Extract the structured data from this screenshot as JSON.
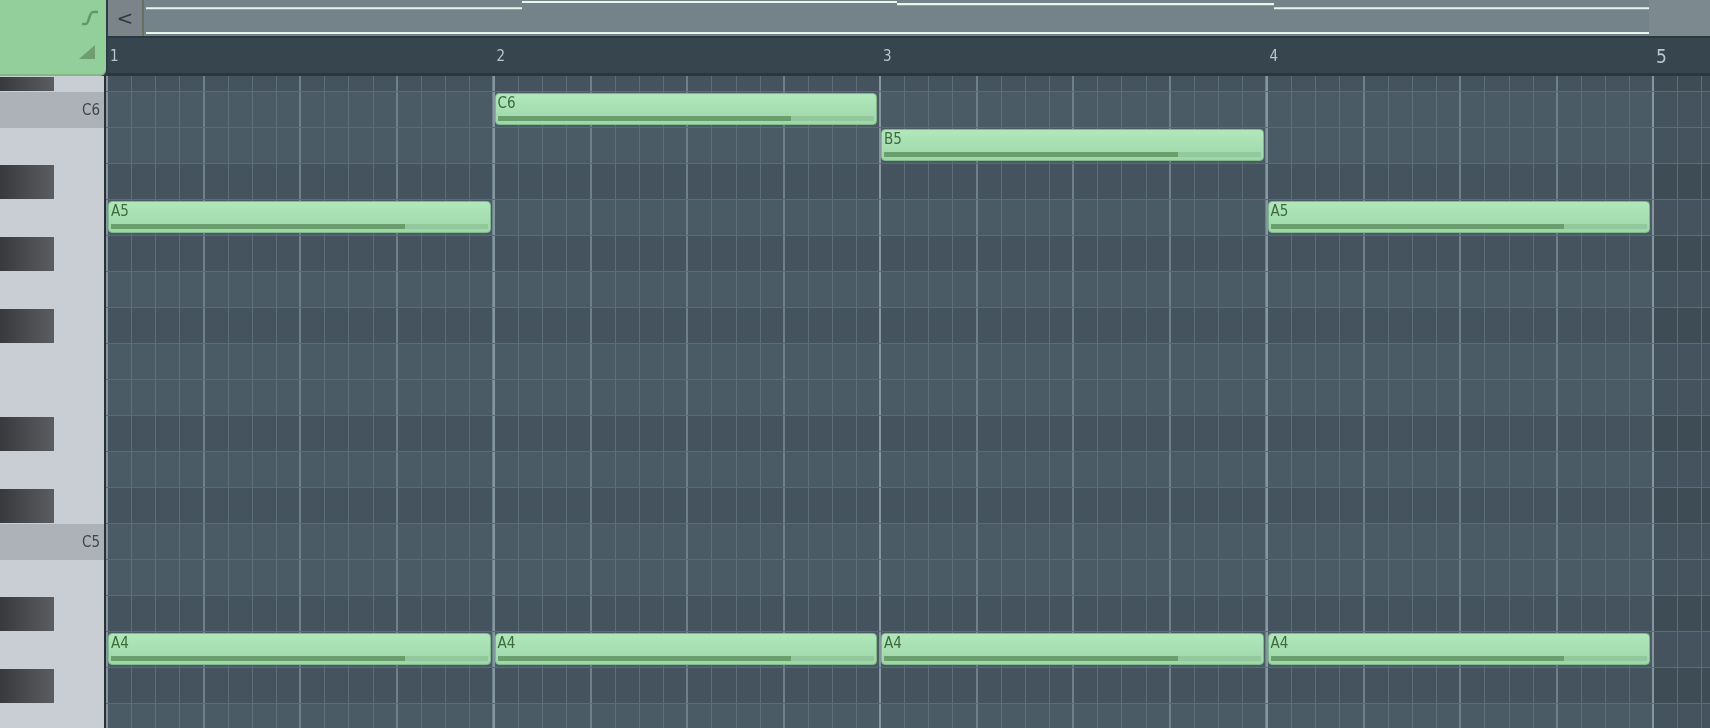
{
  "toolbar": {
    "back_button": "<"
  },
  "ruler": {
    "bars": [
      "1",
      "2",
      "3",
      "4",
      "5"
    ]
  },
  "keys": [
    {
      "kind": "black"
    },
    {
      "kind": "white",
      "label": "C6",
      "bars": [
        {
          "filled": false
        },
        {
          "filled": true,
          "label": "C6",
          "level": 0.78
        },
        {
          "filled": false
        },
        {
          "filled": false
        }
      ]
    },
    {
      "kind": "white",
      "bars": [
        {
          "filled": false
        },
        {
          "filled": false
        },
        {
          "filled": true,
          "label": "B5",
          "level": 0.78
        },
        {
          "filled": false
        }
      ]
    },
    {
      "kind": "black"
    },
    {
      "kind": "white",
      "bars": [
        {
          "filled": true,
          "label": "A5",
          "level": 0.78
        },
        {
          "filled": false
        },
        {
          "filled": false
        },
        {
          "filled": true,
          "label": "A5",
          "level": 0.78
        }
      ]
    },
    {
      "kind": "black"
    },
    {
      "kind": "white"
    },
    {
      "kind": "black"
    },
    {
      "kind": "white"
    },
    {
      "kind": "white"
    },
    {
      "kind": "black"
    },
    {
      "kind": "white"
    },
    {
      "kind": "black"
    },
    {
      "kind": "white",
      "label": "C5"
    },
    {
      "kind": "white"
    },
    {
      "kind": "black"
    },
    {
      "kind": "white",
      "bars": [
        {
          "filled": true,
          "label": "A4",
          "level": 0.78
        },
        {
          "filled": true,
          "label": "A4",
          "level": 0.78
        },
        {
          "filled": true,
          "label": "A4",
          "level": 0.78
        },
        {
          "filled": true,
          "label": "A4",
          "level": 0.78
        }
      ]
    },
    {
      "kind": "black"
    },
    {
      "kind": "white"
    }
  ]
}
